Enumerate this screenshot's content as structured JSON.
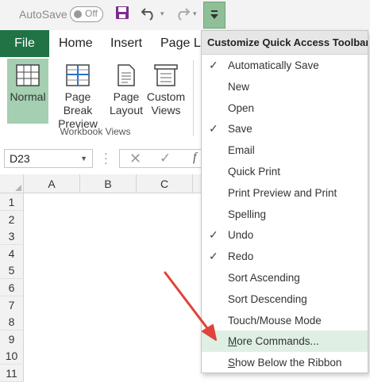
{
  "qat": {
    "autosave_label": "AutoSave",
    "autosave_state": "Off",
    "icons": [
      "save-icon",
      "undo-icon",
      "redo-icon",
      "customize-qat-icon"
    ]
  },
  "tabs": {
    "file": "File",
    "home": "Home",
    "insert": "Insert",
    "page_layout": "Page La"
  },
  "ribbon": {
    "buttons": [
      {
        "label": "Normal",
        "icon": "normal-view-icon"
      },
      {
        "label": "Page Break Preview",
        "icon": "page-break-preview-icon"
      },
      {
        "label": "Page Layout",
        "icon": "page-layout-icon"
      },
      {
        "label": "Custom Views",
        "icon": "custom-views-icon"
      }
    ],
    "group_label": "Workbook Views"
  },
  "formula_bar": {
    "name_box": "D23",
    "fx": "f"
  },
  "grid": {
    "columns": [
      "A",
      "B",
      "C"
    ],
    "rows": [
      "1",
      "2",
      "3",
      "4",
      "5",
      "6",
      "7",
      "8",
      "9",
      "10",
      "11"
    ]
  },
  "menu": {
    "title": "Customize Quick Access Toolbar",
    "items": [
      {
        "label": "Automatically Save",
        "checked": true
      },
      {
        "label": "New",
        "checked": false
      },
      {
        "label": "Open",
        "checked": false
      },
      {
        "label": "Save",
        "checked": true
      },
      {
        "label": "Email",
        "checked": false
      },
      {
        "label": "Quick Print",
        "checked": false
      },
      {
        "label": "Print Preview and Print",
        "checked": false
      },
      {
        "label": "Spelling",
        "checked": false
      },
      {
        "label": "Undo",
        "checked": true
      },
      {
        "label": "Redo",
        "checked": true
      },
      {
        "label": "Sort Ascending",
        "checked": false
      },
      {
        "label": "Sort Descending",
        "checked": false
      },
      {
        "label": "Touch/Mouse Mode",
        "checked": false
      },
      {
        "label": "More Commands...",
        "checked": false,
        "highlighted": true,
        "access_key": "M"
      },
      {
        "label": "Show Below the Ribbon",
        "checked": false,
        "access_key": "S"
      }
    ],
    "check_glyph": "✓"
  },
  "colors": {
    "excel_green": "#217346",
    "active_view": "#a4cfb0",
    "menu_highlight": "#dfefe3",
    "arrow": "#e0433b"
  }
}
